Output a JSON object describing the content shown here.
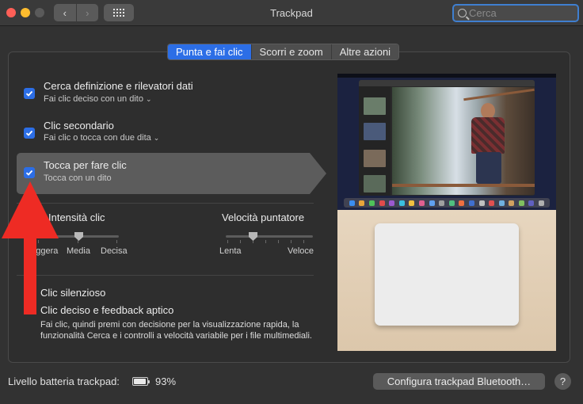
{
  "window": {
    "title": "Trackpad",
    "search_placeholder": "Cerca",
    "nav_back": "‹",
    "nav_forward": "›"
  },
  "tabs": [
    {
      "label": "Punta e fai clic",
      "active": true
    },
    {
      "label": "Scorri e zoom",
      "active": false
    },
    {
      "label": "Altre azioni",
      "active": false
    }
  ],
  "options": [
    {
      "title": "Cerca definizione e rilevatori dati",
      "subtitle": "Fai clic deciso con un dito",
      "checked": true
    },
    {
      "title": "Clic secondario",
      "subtitle": "Fai clic o tocca con due dita",
      "checked": true
    },
    {
      "title": "Tocca per fare clic",
      "subtitle": "Tocca con un dito",
      "checked": true
    }
  ],
  "click_intensity": {
    "label": "Intensità clic",
    "ticks": [
      "Leggera",
      "Media",
      "Decisa"
    ],
    "value": "Media"
  },
  "pointer_speed": {
    "label": "Velocità puntatore",
    "min_label": "Lenta",
    "max_label": "Veloce",
    "value": 0.3
  },
  "silent_click": {
    "label": "Clic silenzioso"
  },
  "force_click": {
    "label": "Clic deciso e feedback aptico",
    "description": "Fai clic, quindi premi con decisione per la visualizzazione rapida, la funzionalità Cerca e i controlli a velocità variabile per i file multimediali."
  },
  "footer": {
    "battery_label": "Livello batteria trackpad:",
    "battery_percent": "93%",
    "battery_level": 0.93,
    "configure_button": "Configura trackpad Bluetooth…",
    "help_label": "?"
  },
  "colors": {
    "accent": "#2c6ee6",
    "annotation_arrow": "#ee2b24"
  }
}
